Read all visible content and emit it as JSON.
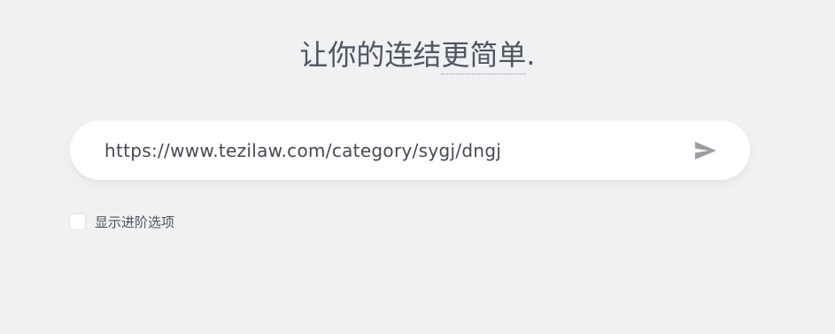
{
  "headline": {
    "prefix": "让你的连结",
    "emphasis": "更简单",
    "suffix": "."
  },
  "url_input": {
    "value": "https://www.tezilaw.com/category/sygj/dngj",
    "placeholder": ""
  },
  "send_button": {
    "icon": "send-icon",
    "color": "#9a9ea4"
  },
  "advanced_options": {
    "label": "显示进阶选项",
    "checked": false
  }
}
